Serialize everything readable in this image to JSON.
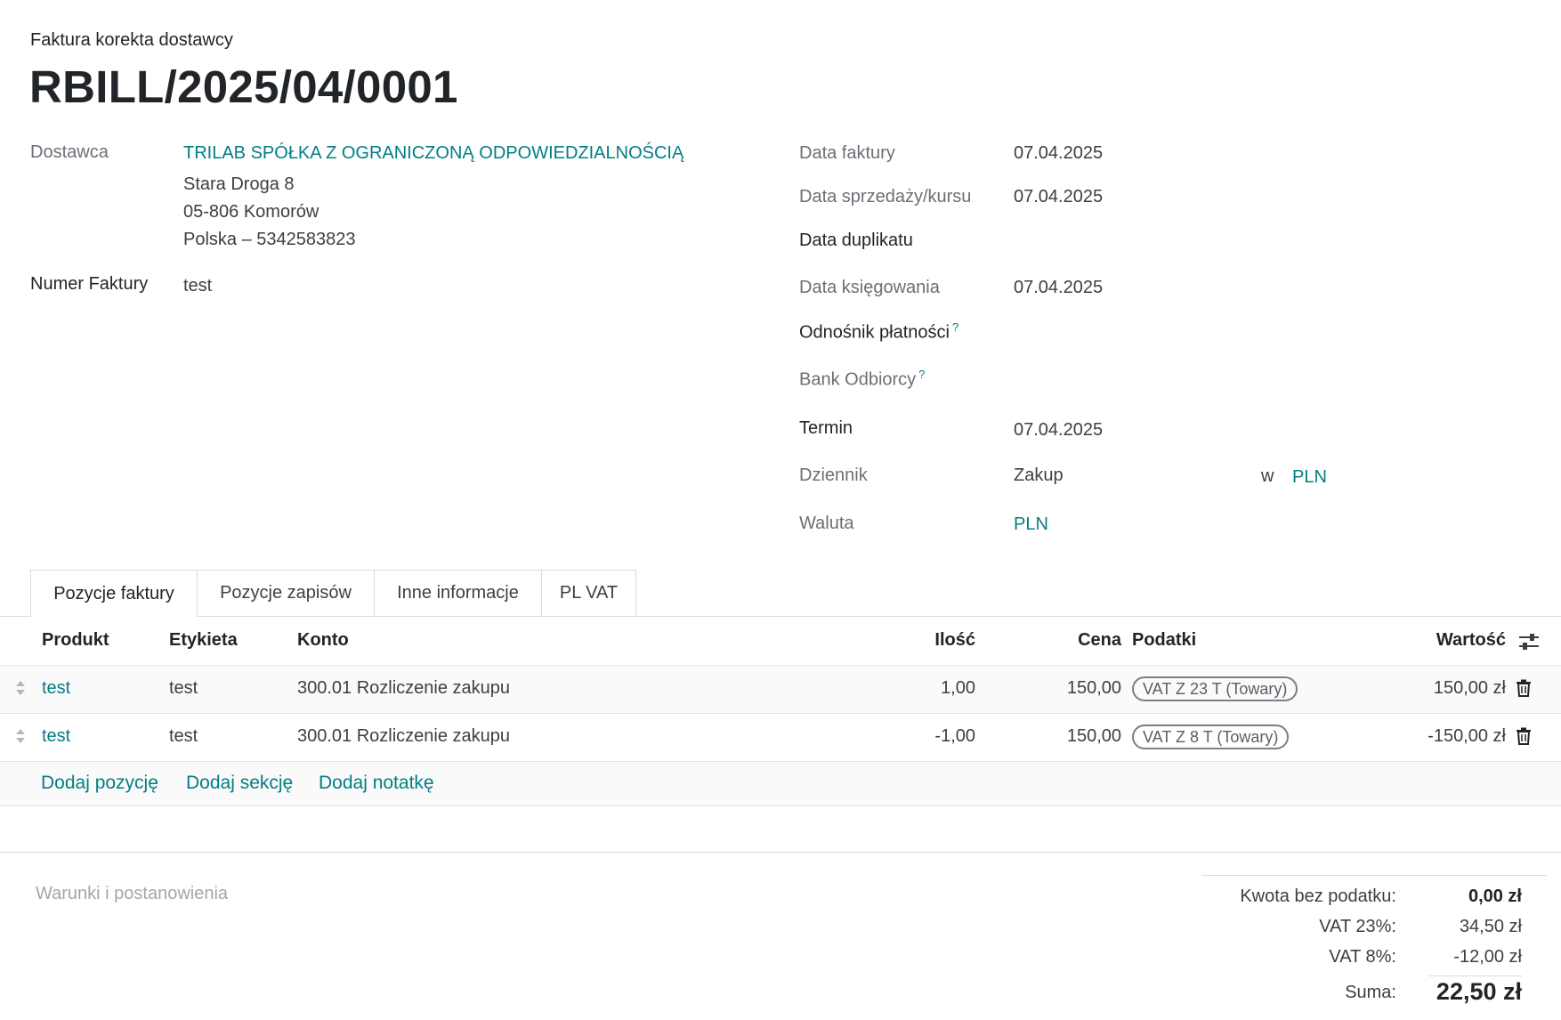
{
  "header": {
    "doc_type": "Faktura korekta dostawcy",
    "doc_number": "RBILL/2025/04/0001"
  },
  "vendor": {
    "label": "Dostawca",
    "name": "TRILAB SPÓŁKA Z OGRANICZONĄ ODPOWIEDZIALNOŚCIĄ",
    "address_line1": "Stara Droga 8",
    "address_line2": "05-806 Komorów",
    "address_line3": "Polska – 5342583823"
  },
  "invoice_number": {
    "label": "Numer Faktury",
    "value": "test"
  },
  "right_fields": {
    "invoice_date": {
      "label": "Data faktury",
      "value": "07.04.2025"
    },
    "sale_date": {
      "label": "Data sprzedaży/kursu",
      "value": "07.04.2025"
    },
    "duplicate_date": {
      "label": "Data duplikatu",
      "value": ""
    },
    "posting_date": {
      "label": "Data księgowania",
      "value": "07.04.2025"
    },
    "payment_ref": {
      "label": "Odnośnik płatności",
      "help": "?"
    },
    "recipient_bank": {
      "label": "Bank Odbiorcy",
      "help": "?"
    },
    "due_date": {
      "label": "Termin",
      "value": "07.04.2025"
    },
    "journal": {
      "label": "Dziennik",
      "value": "Zakup",
      "in_label": "w",
      "currency": "PLN"
    },
    "currency": {
      "label": "Waluta",
      "value": "PLN"
    }
  },
  "tabs": [
    {
      "label": "Pozycje faktury",
      "active": true
    },
    {
      "label": "Pozycje zapisów",
      "active": false
    },
    {
      "label": "Inne informacje",
      "active": false
    },
    {
      "label": "PL VAT",
      "active": false
    }
  ],
  "table": {
    "headers": {
      "product": "Produkt",
      "label": "Etykieta",
      "account": "Konto",
      "quantity": "Ilość",
      "price": "Cena",
      "taxes": "Podatki",
      "amount": "Wartość"
    },
    "rows": [
      {
        "product": "test",
        "label": "test",
        "account": "300.01 Rozliczenie zakupu",
        "quantity": "1,00",
        "price": "150,00",
        "tax": "VAT Z 23 T (Towary)",
        "amount": "150,00 zł"
      },
      {
        "product": "test",
        "label": "test",
        "account": "300.01 Rozliczenie zakupu",
        "quantity": "-1,00",
        "price": "150,00",
        "tax": "VAT Z 8 T (Towary)",
        "amount": "-150,00 zł"
      }
    ],
    "actions": {
      "add_line": "Dodaj pozycję",
      "add_section": "Dodaj sekcję",
      "add_note": "Dodaj notatkę"
    }
  },
  "terms_placeholder": "Warunki i postanowienia",
  "totals": {
    "untaxed_label": "Kwota bez podatku:",
    "untaxed_value": "0,00 zł",
    "vat23_label": "VAT 23%:",
    "vat23_value": "34,50 zł",
    "vat8_label": "VAT 8%:",
    "vat8_value": "-12,00 zł",
    "total_label": "Suma:",
    "total_value": "22,50 zł"
  },
  "colors": {
    "link": "#017e84",
    "highlight_underline": "#e0322b"
  }
}
